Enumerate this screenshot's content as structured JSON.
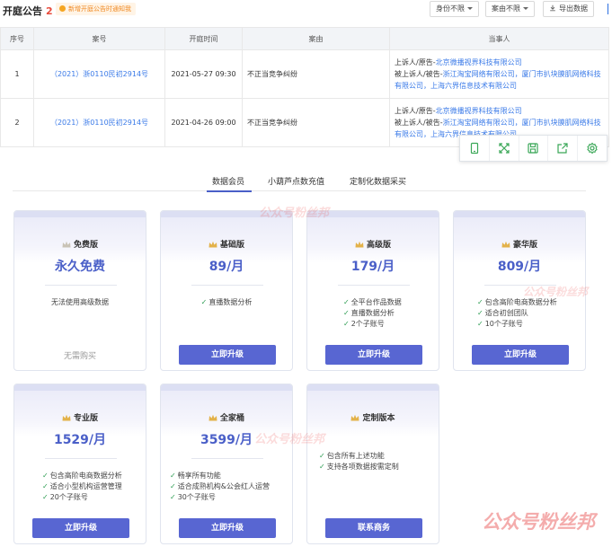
{
  "header": {
    "title": "开庭公告",
    "count": "2",
    "tip": "新增开庭公告时通知我",
    "filter_identity": "身份不限",
    "filter_cause": "案由不限",
    "export": "导出数据"
  },
  "table": {
    "columns": [
      "序号",
      "案号",
      "开庭时间",
      "案由",
      "当事人"
    ],
    "rows": [
      {
        "index": "1",
        "case_no": "（2021）浙0110民初2914号",
        "time": "2021-05-27 09:30",
        "cause": "不正当竞争纠纷",
        "plaintiff_label": "上诉人/原告-",
        "plaintiff": "北京微播视界科技有限公司",
        "defendant_label": "被上诉人/被告-",
        "defendant": "浙江淘宝网络有限公司，厦门市扒块膜肌网络科技有限公司，上海六界信息技术有限公司"
      },
      {
        "index": "2",
        "case_no": "（2021）浙0110民初2914号",
        "time": "2021-04-26 09:00",
        "cause": "不正当竞争纠纷",
        "plaintiff_label": "上诉人/原告-",
        "plaintiff": "北京微播视界科技有限公司",
        "defendant_label": "被上诉人/被告-",
        "defendant": "浙江淘宝网络有限公司，厦门市扒块膜肌网络科技有限公司，上海六界信息技术有限公司"
      }
    ]
  },
  "toolbar_icons": [
    "phone-icon",
    "expand-icon",
    "save-icon",
    "share-icon",
    "settings-icon"
  ],
  "tabs": [
    "数据会员",
    "小葫芦点数充值",
    "定制化数据采买"
  ],
  "active_tab": 0,
  "plans": [
    {
      "name": "免费版",
      "price": "永久免费",
      "features": [
        "无法使用高级数据"
      ],
      "plain": true,
      "action": "无需购买"
    },
    {
      "name": "基础版",
      "price": "89/月",
      "features": [
        "直播数据分析"
      ],
      "action": "立即升级"
    },
    {
      "name": "高级版",
      "price": "179/月",
      "features": [
        "全平台作品数据",
        "直播数据分析",
        "2个子账号"
      ],
      "action": "立即升级"
    },
    {
      "name": "豪华版",
      "price": "809/月",
      "features": [
        "包含高阶电商数据分析",
        "适合初创团队",
        "10个子账号"
      ],
      "action": "立即升级"
    },
    {
      "name": "专业版",
      "price": "1529/月",
      "features": [
        "包含高阶电商数据分析",
        "适合小型机构运营管理",
        "20个子账号"
      ],
      "action": "立即升级"
    },
    {
      "name": "全家桶",
      "price": "3599/月",
      "features": [
        "畅享所有功能",
        "适合成熟机构&公会红人运营",
        "30个子账号"
      ],
      "action": "立即升级"
    },
    {
      "name": "定制版本",
      "price": "",
      "features": [
        "包含所有上述功能",
        "支持各项数据按需定制"
      ],
      "action": "联系商务"
    }
  ],
  "watermark": "公众号粉丝邦",
  "colors": {
    "accent": "#5866d2",
    "link": "#3a7ae8",
    "badge": "#e84c3d",
    "check": "#2f9e54"
  }
}
